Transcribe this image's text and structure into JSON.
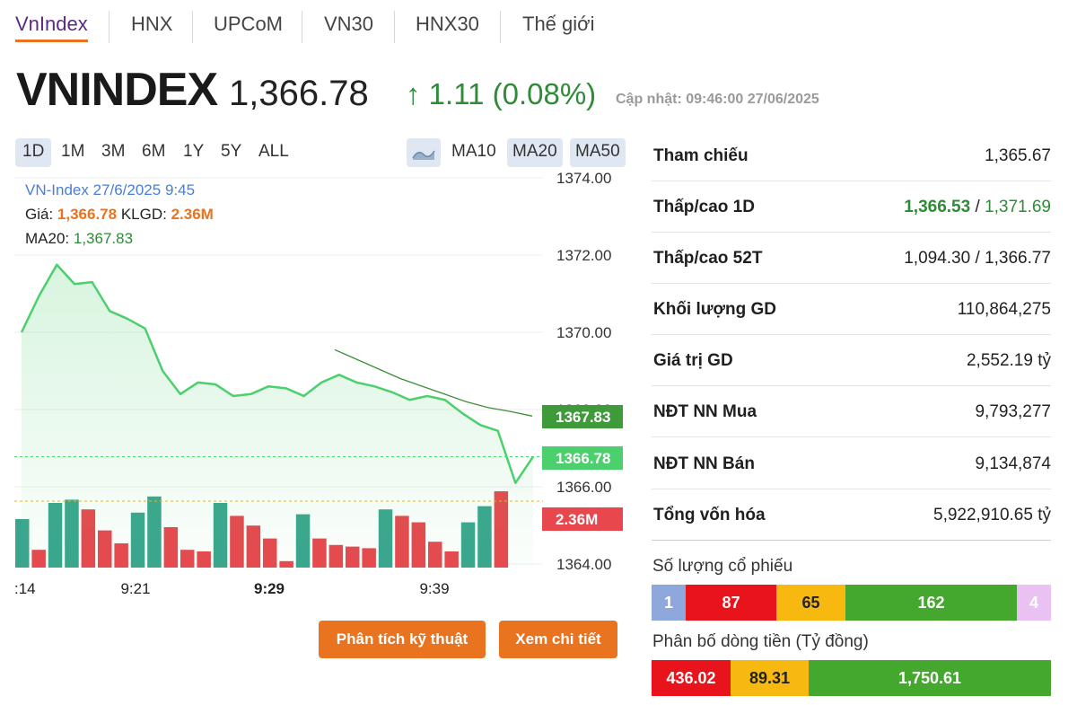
{
  "tabs": [
    {
      "label": "VnIndex"
    },
    {
      "label": "HNX"
    },
    {
      "label": "UPCoM"
    },
    {
      "label": "VN30"
    },
    {
      "label": "HNX30"
    },
    {
      "label": "Thế giới"
    }
  ],
  "header": {
    "title": "VNINDEX",
    "price": "1,366.78",
    "change": "↑ 1.11  (0.08%)",
    "updated": "Cập nhật: 09:46:00 27/06/2025"
  },
  "ranges": [
    "1D",
    "1M",
    "3M",
    "6M",
    "1Y",
    "5Y",
    "ALL"
  ],
  "ma_buttons": [
    "MA10",
    "MA20",
    "MA50"
  ],
  "legend": {
    "name": "VN-Index 27/6/2025 9:45",
    "price_label": "Giá: ",
    "price_value": "1,366.78",
    "vol_label": " KLGD: ",
    "vol_value": "2.36M",
    "ma_label": "MA20: ",
    "ma_value": "1,367.83"
  },
  "chart_data": {
    "type": "line",
    "x": [
      "9:14",
      "9:16",
      "9:17",
      "9:18",
      "9:19",
      "9:20",
      "9:21",
      "9:23",
      "9:24",
      "9:25",
      "9:26",
      "9:27",
      "9:28",
      "9:29",
      "9:30",
      "9:31",
      "9:32",
      "9:33",
      "9:34",
      "9:35",
      "9:36",
      "9:37",
      "9:38",
      "9:39",
      "9:41",
      "9:42",
      "9:43",
      "9:44",
      "9:45"
    ],
    "series": [
      {
        "values": [
          1370.0,
          1370.95,
          1371.75,
          1371.25,
          1371.3,
          1370.55,
          1370.35,
          1370.1,
          1369.0,
          1368.4,
          1368.7,
          1368.65,
          1368.35,
          1368.4,
          1368.6,
          1368.55,
          1368.35,
          1368.7,
          1368.9,
          1368.7,
          1368.6,
          1368.45,
          1368.25,
          1368.35,
          1368.25,
          1367.9,
          1367.6,
          1367.45,
          1366.1,
          1366.78
        ]
      }
    ],
    "ma20": [
      null,
      null,
      null,
      null,
      null,
      null,
      null,
      null,
      null,
      null,
      null,
      null,
      null,
      null,
      null,
      null,
      null,
      null,
      null,
      1369.55,
      1369.3,
      1369.05,
      1368.8,
      1368.6,
      1368.4,
      1368.2,
      1368.05,
      1367.95,
      1367.83
    ],
    "volume": [
      1.5,
      0.55,
      2.0,
      2.1,
      1.8,
      1.15,
      0.75,
      1.7,
      2.2,
      1.25,
      0.55,
      0.5,
      2.0,
      1.6,
      1.3,
      0.9,
      0.2,
      1.65,
      0.9,
      0.7,
      0.65,
      0.6,
      1.8,
      1.6,
      1.4,
      0.8,
      0.5,
      1.4,
      1.9,
      2.36
    ],
    "volume_up": [
      true,
      false,
      true,
      true,
      false,
      false,
      false,
      true,
      true,
      false,
      false,
      false,
      true,
      false,
      false,
      false,
      false,
      true,
      false,
      false,
      false,
      false,
      true,
      false,
      false,
      false,
      false,
      true,
      true,
      false,
      true,
      false
    ],
    "y_ticks": [
      "1374.00",
      "1372.00",
      "1370.00",
      "1368.00",
      "1366.00",
      "1364.00"
    ],
    "ylim": [
      1364,
      1374
    ],
    "x_tick_labels": [
      ":14",
      "9:21",
      "9:29",
      "9:39"
    ],
    "price_tag": "1366.78",
    "ma_tag": "1367.83",
    "vol_tag": "2.36M"
  },
  "colors": {
    "price_line": "#4ccf6d",
    "ma_line": "#3f8f37",
    "vol_up": "#3aa58e",
    "vol_down": "#e8474d",
    "accent": "#e9731f"
  },
  "buttons": {
    "analysis": "Phân tích kỹ thuật",
    "detail": "Xem chi tiết"
  },
  "stats": [
    {
      "label": "Tham chiếu",
      "value": "1,365.67"
    },
    {
      "label": "Thấp/cao 1D",
      "low": "1,366.53",
      "sep": " / ",
      "high": "1,371.69"
    },
    {
      "label": "Thấp/cao 52T",
      "value": "1,094.30 / 1,366.77"
    },
    {
      "label": "Khối lượng GD",
      "value": "110,864,275"
    },
    {
      "label": "Giá trị GD",
      "value": "2,552.19 tỷ"
    },
    {
      "label": "NĐT NN Mua",
      "value": "9,793,277"
    },
    {
      "label": "NĐT NN Bán",
      "value": "9,134,874"
    },
    {
      "label": "Tổng vốn hóa",
      "value": "5,922,910.65 tỷ"
    }
  ],
  "stock_count": {
    "title": "Số lượng cổ phiếu",
    "segments": [
      {
        "value": "1",
        "color": "#8ea8db",
        "text": "#ffffff"
      },
      {
        "value": "87",
        "color": "#e8131b",
        "text": "#ffffff"
      },
      {
        "value": "65",
        "color": "#f7b90f",
        "text": "#222222"
      },
      {
        "value": "162",
        "color": "#44a82f",
        "text": "#ffffff"
      },
      {
        "value": "4",
        "color": "#e9c2f3",
        "text": "#ffffff"
      }
    ]
  },
  "money_flow": {
    "title": "Phân bố dòng tiền (Tỷ đồng)",
    "segments": [
      {
        "value": "436.02",
        "color": "#e8131b",
        "text": "#ffffff"
      },
      {
        "value": "89.31",
        "color": "#f7b90f",
        "text": "#222222"
      },
      {
        "value": "1,750.61",
        "color": "#44a82f",
        "text": "#ffffff"
      }
    ]
  }
}
